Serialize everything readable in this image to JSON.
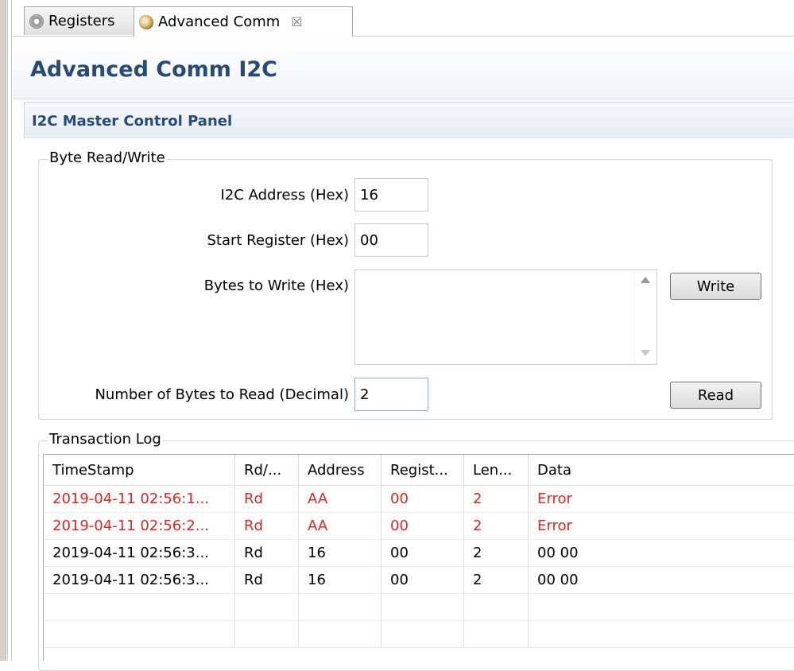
{
  "tabs": [
    {
      "label": "Registers",
      "icon": "gear-icon",
      "active": false
    },
    {
      "label": "Advanced Comm",
      "icon": "comm-icon",
      "active": true,
      "close": "☒"
    }
  ],
  "page": {
    "title": "Advanced Comm I2C"
  },
  "section": {
    "title": "I2C Master Control Panel"
  },
  "byte_rw": {
    "legend": "Byte Read/Write",
    "i2c_address_label": "I2C Address (Hex)",
    "i2c_address_value": "16",
    "start_register_label": "Start Register (Hex)",
    "start_register_value": "00",
    "bytes_to_write_label": "Bytes to Write (Hex)",
    "bytes_to_write_value": "",
    "write_button": "Write",
    "num_bytes_read_label": "Number of Bytes to Read (Decimal)",
    "num_bytes_read_value": "2",
    "read_button": "Read"
  },
  "log": {
    "legend": "Transaction Log",
    "columns": [
      "TimeStamp",
      "Rd/...",
      "Address",
      "Regist...",
      "Len...",
      "Data"
    ],
    "rows": [
      {
        "error": true,
        "cells": [
          "2019-04-11 02:56:1...",
          "Rd",
          "AA",
          "00",
          "2",
          "Error"
        ]
      },
      {
        "error": true,
        "cells": [
          "2019-04-11 02:56:2...",
          "Rd",
          "AA",
          "00",
          "2",
          "Error"
        ]
      },
      {
        "error": false,
        "cells": [
          "2019-04-11 02:56:3...",
          "Rd",
          "16",
          "00",
          "2",
          "00 00"
        ]
      },
      {
        "error": false,
        "cells": [
          "2019-04-11 02:56:3...",
          "Rd",
          "16",
          "00",
          "2",
          "00 00"
        ]
      },
      {
        "error": false,
        "cells": [
          "",
          "",
          "",
          "",
          "",
          ""
        ]
      },
      {
        "error": false,
        "cells": [
          "",
          "",
          "",
          "",
          "",
          ""
        ]
      }
    ]
  },
  "colors": {
    "title": "#274a79",
    "error_text": "#e0261f"
  }
}
